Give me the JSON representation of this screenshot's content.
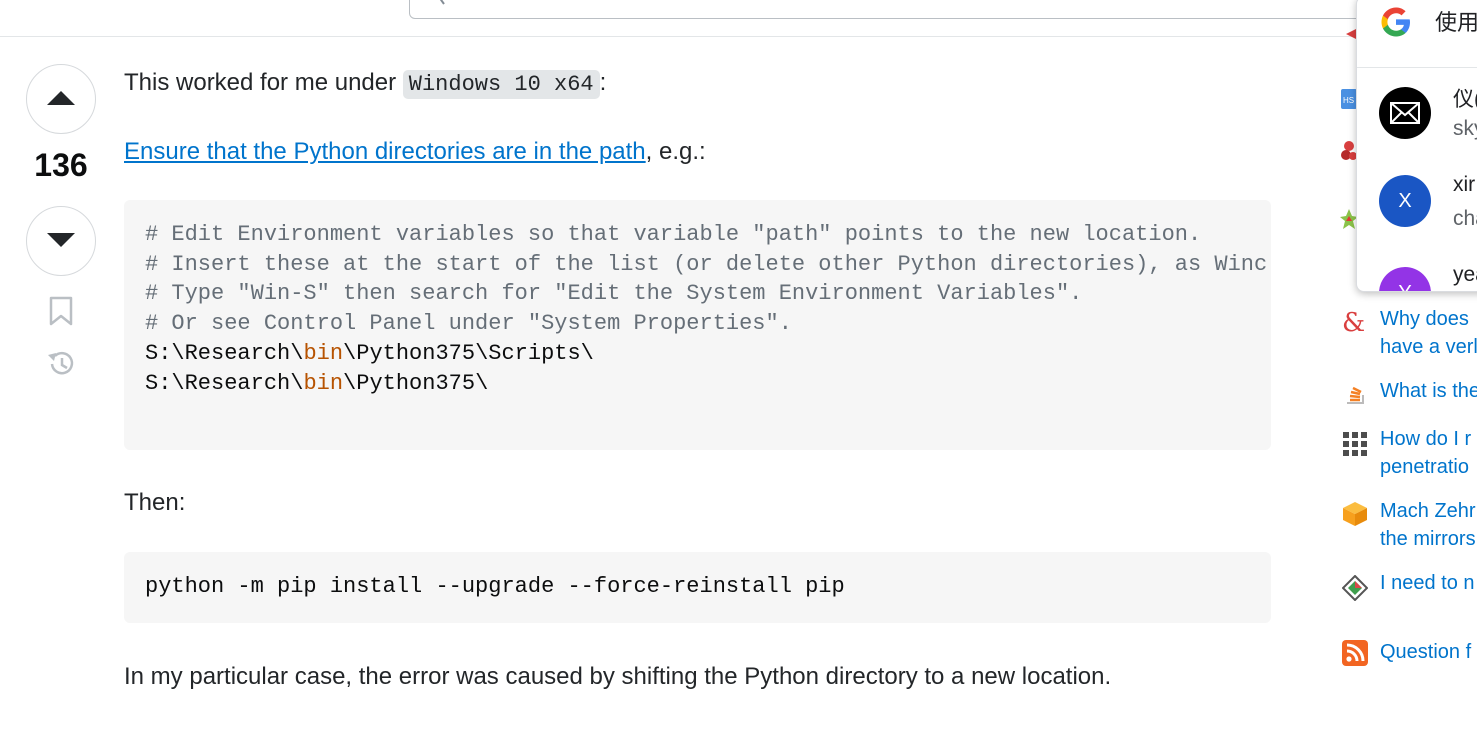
{
  "answer": {
    "vote_count": "136",
    "intro_prefix": "This worked for me under ",
    "intro_code": "Windows 10 x64",
    "intro_suffix": ":",
    "link_text": "Ensure that the Python directories are in the path",
    "link_suffix": ", e.g.:",
    "code_block_1": {
      "comment_lines": [
        "# Edit Environment variables so that variable \"path\" points to the new location.",
        "# Insert these at the start of the list (or delete other Python directories), as Winc",
        "# Type \"Win-S\" then search for \"Edit the System Environment Variables\".",
        "# Or see Control Panel under \"System Properties\"."
      ],
      "path_lines": [
        {
          "pre": "S:\\Research\\",
          "kw": "bin",
          "post": "\\Python375\\Scripts\\"
        },
        {
          "pre": "S:\\Research\\",
          "kw": "bin",
          "post": "\\Python375\\"
        }
      ]
    },
    "then_text": "Then:",
    "code_block_2": "python -m pip install --upgrade --force-reinstall pip",
    "closing_text": "In my particular case, the error was caused by shifting the Python directory to a new location."
  },
  "sidebar": {
    "items": [
      {
        "icon": "perl-icon",
        "lines": [
          "Why does",
          "have a verl"
        ],
        "color": "#d93f3f"
      },
      {
        "icon": "stackoverflow-icon",
        "lines": [
          "What is the"
        ],
        "color": "#f48024"
      },
      {
        "icon": "grid-site-icon",
        "lines": [
          "How do I r",
          "penetratio"
        ],
        "color": "#4d4d4d"
      },
      {
        "icon": "cube-icon",
        "lines": [
          "Mach Zehr",
          "the mirrors"
        ],
        "color": "#f7a01d"
      },
      {
        "icon": "diamond-site-icon",
        "lines": [
          "I need to n"
        ],
        "color": "#3f9e4d"
      },
      {
        "icon": "rss-icon",
        "lines": [
          "Question f"
        ],
        "color": "#f26522"
      }
    ]
  },
  "account_popup": {
    "header_text": "使用",
    "accounts": [
      {
        "avatar": "mail-icon",
        "name": "仪(",
        "email": "sky"
      },
      {
        "avatar": "X",
        "name": "xir",
        "email": "cha"
      },
      {
        "avatar": "Y",
        "name": "yea",
        "email": ""
      }
    ]
  }
}
